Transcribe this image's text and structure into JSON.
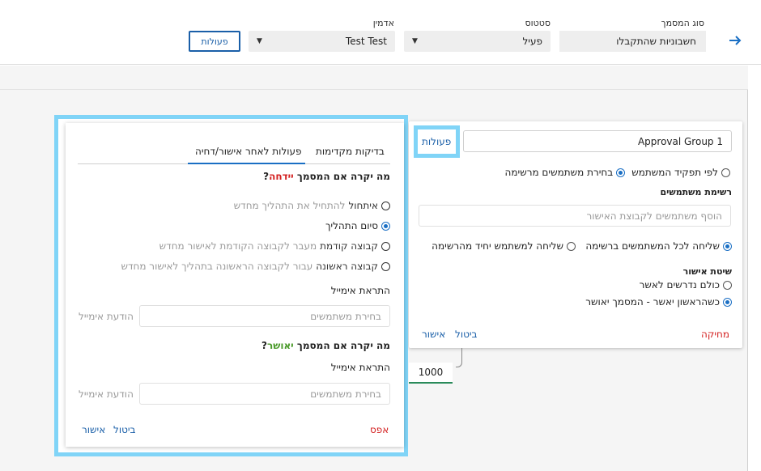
{
  "header": {
    "doc_type_label": "סוג המסמך",
    "doc_type_value": "חשבוניות שהתקבלו",
    "status_label": "סטטוס",
    "status_value": "פעיל",
    "admin_label": "אדמין",
    "admin_value": "Test Test",
    "actions_button": "פעולות"
  },
  "group_card": {
    "group_name": "Approval Group 1",
    "actions_link": "פעולות",
    "radio_by_role": "לפי תפקיד המשתמש",
    "radio_from_list": "בחירת משתמשים מרשימה",
    "users_list_title": "רשימת משתמשים",
    "add_users_placeholder": "הוסף משתמשים לקבוצת האישור",
    "send_all": "שליחה לכל המשתמשים ברשימה",
    "send_one": "שליחה למשתמש יחיד מהרשימה",
    "approval_method_title": "שיטת אישור",
    "all_required": "כולם נדרשים לאשר",
    "first_approves": "כשהראשון יאשר - המסמך יאושר",
    "delete": "מחיקה",
    "cancel": "ביטול",
    "approve": "אישור"
  },
  "amount_value": "1000",
  "modal": {
    "tab_prechecks": "בדיקות מקדימות",
    "tab_post_actions": "פעולות לאחר אישור/דחיה",
    "reject_question_prefix": "מה יקרה אם המסמך ",
    "reject_word": "יידחה",
    "question_mark": "?",
    "opt_reset_bold": "איתחול",
    "opt_reset_rest": " להתחיל את התהליך מחדש",
    "opt_end": "סיום התהליך",
    "opt_prev_bold": "קבוצה קודמת",
    "opt_prev_rest": " מעבר לקבוצה הקודמת לאישור מחדש",
    "opt_first_bold": "קבוצה ראשונה",
    "opt_first_rest": " עבור לקבוצה הראשונה בתהליך לאישור מחדש",
    "email_alert": "התראת אימייל",
    "select_users_placeholder": "בחירת משתמשים",
    "email_message": "הודעת אימייל",
    "approve_question_prefix": "מה יקרה אם המסמך ",
    "approve_word": "יאושר",
    "email_alert_2": "התראת אימייל",
    "select_users_placeholder_2": "בחירת משתמשים",
    "email_message_2": "הודעת אימייל",
    "reset": "אפס",
    "cancel": "ביטול",
    "approve": "אישור"
  },
  "colors": {
    "accent": "#1a6fc4",
    "highlight": "#80d4f7",
    "danger": "#d32020",
    "success": "#4a9a2a"
  }
}
